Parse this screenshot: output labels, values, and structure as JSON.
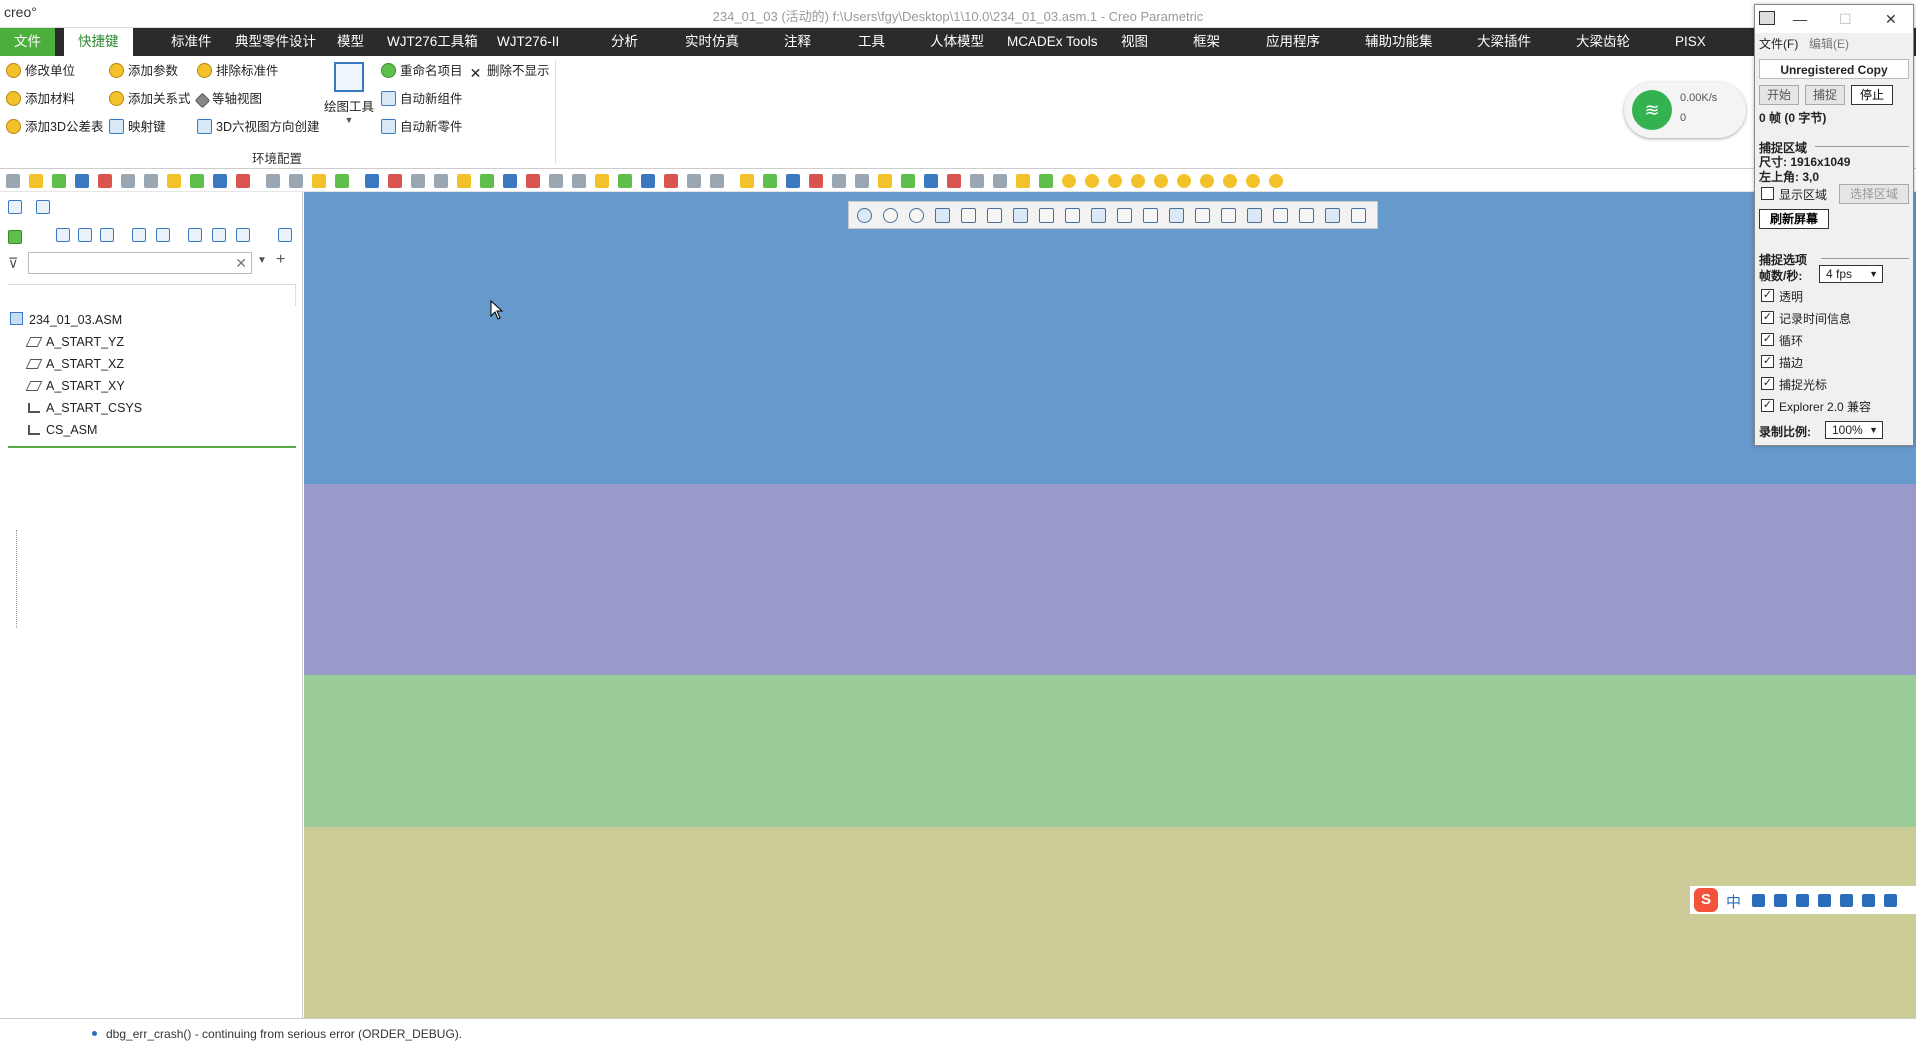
{
  "window": {
    "app_logo": "creo°",
    "title": "234_01_03 (活动的) f:\\Users\\fgy\\Desktop\\1\\10.0\\234_01_03.asm.1 - Creo Parametric"
  },
  "menubar": {
    "items": [
      "文件",
      "快捷键",
      "标准件",
      "典型零件设计",
      "模型",
      "WJT276工具箱",
      "WJT276-II",
      "分析",
      "实时仿真",
      "注释",
      "工具",
      "人体模型",
      "MCADEx Tools",
      "视图",
      "框架",
      "应用程序",
      "辅助功能集",
      "大梁插件",
      "大梁齿轮",
      "PISX"
    ],
    "active": "快捷键"
  },
  "ribbon": {
    "buttons": [
      "修改单位",
      "添加参数",
      "排除标准件",
      "添加材料",
      "添加关系式",
      "等轴视图",
      "添加3D公差表",
      "映射键",
      "3D六视图方向创建",
      "重命名项目",
      "删除不显示",
      "自动新组件",
      "自动新零件"
    ],
    "big_button": "绘图工具",
    "group_label": "环境配置"
  },
  "network_widget": {
    "speed": "0.00K/s",
    "count": "0"
  },
  "model_tree": {
    "root": "234_01_03.ASM",
    "items": [
      "A_START_YZ",
      "A_START_XZ",
      "A_START_XY",
      "A_START_CSYS",
      "CS_ASM"
    ],
    "filter_placeholder": ""
  },
  "graphics": {
    "band_colors": [
      "#6699cc",
      "#9999cc",
      "#99cc99",
      "#cccc99"
    ]
  },
  "status": {
    "message": "dbg_err_crash() - continuing from serious error (ORDER_DEBUG)."
  },
  "capture_tool": {
    "menu_file": "文件(F)",
    "menu_edit": "编辑(E)",
    "registration": "Unregistered Copy",
    "btn_start": "开始",
    "btn_capture": "捕捉",
    "btn_stop": "停止",
    "frames": "0 帧 (0 字节)",
    "section_region": "捕捉区域",
    "size": "尺寸: 1916x1049",
    "top_left": "左上角: 3,0",
    "show_region": "显示区域",
    "select_region": "选择区域",
    "refresh": "刷新屏幕",
    "section_options": "捕捉选项",
    "fps_label": "帧数/秒:",
    "fps_value": "4 fps",
    "options": [
      "透明",
      "记录时间信息",
      "循环",
      "描边",
      "捕捉光标",
      "Explorer 2.0 兼容"
    ],
    "scale_label": "录制比例:",
    "scale_value": "100%"
  },
  "ime": {
    "logo": "S",
    "lang": "中"
  }
}
